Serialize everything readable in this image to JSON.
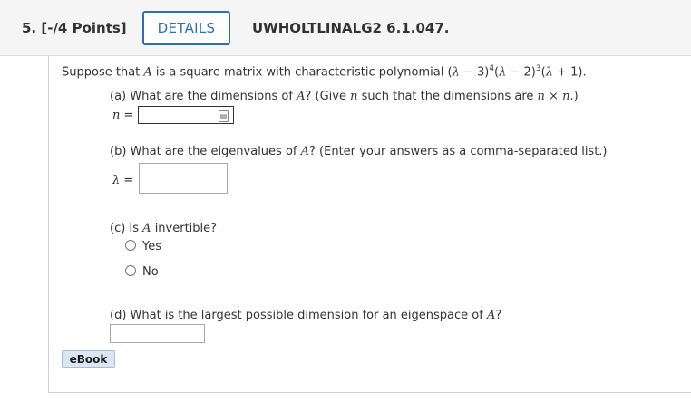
{
  "header": {
    "question_number": "5.  [-/4 Points]",
    "details_label": "DETAILS",
    "question_id": "UWHOLTLINALG2 6.1.047."
  },
  "problem": {
    "intro_prefix": "Suppose that ",
    "intro_var": "A",
    "intro_middle": " is a square matrix with characteristic polynomial  (",
    "poly_lambda": "λ",
    "poly_t1": " − 3)",
    "poly_e1": "4",
    "poly_t2": "(",
    "poly_t3": " − 2)",
    "poly_e2": "3",
    "poly_t4": "(",
    "poly_t5": " + 1)."
  },
  "part_a": {
    "question_prefix": "(a) What are the dimensions of ",
    "question_var": "A",
    "question_middle": "? (Give ",
    "n_var": "n",
    "question_suffix": " such that the dimensions are  ",
    "dims": "n × n",
    "question_end": ".)",
    "input_label_var": "n",
    "input_label_eq": " = ",
    "input_value": ""
  },
  "part_b": {
    "question_prefix": "(b) What are the eigenvalues of ",
    "question_var": "A",
    "question_suffix": "? (Enter your answers as a comma-separated list.)",
    "input_label_var": "λ",
    "input_label_eq": " = ",
    "input_value": ""
  },
  "part_c": {
    "question_prefix": "(c) Is ",
    "question_var": "A",
    "question_suffix": " invertible?",
    "options": [
      "Yes",
      "No"
    ]
  },
  "part_d": {
    "question_prefix": "(d) What is the largest possible dimension for an eigenspace of ",
    "question_var": "A",
    "question_suffix": "?",
    "input_value": ""
  },
  "ebook_label": "eBook"
}
